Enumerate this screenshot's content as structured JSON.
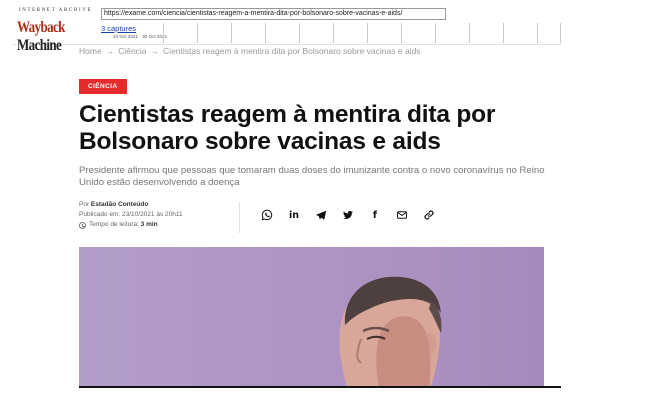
{
  "wayback": {
    "logo_top": "INTERNET ARCHIVE",
    "logo_main_1": "Wayback",
    "logo_main_2": "Machine",
    "url": "https://exame.com/ciencia/cientistas-reagem-a-mentira-dita-por-bolsonaro-sobre-vacinas-e-aids/",
    "captures": "3 captures",
    "date_range": "24 Oct 2021 - 30 Oct 2021"
  },
  "breadcrumb": {
    "home": "Home",
    "sep": "→",
    "section": "Ciência",
    "current": "Cientistas reagem à mentira dita por Bolsonaro sobre vacinas e aids"
  },
  "article": {
    "category": "CIÊNCIA",
    "title": "Cientistas reagem à mentira dita por Bolsonaro sobre vacinas e aids",
    "subtitle": "Presidente afirmou que pessoas que tomaram duas doses do imunizante contra o novo coronavírus no Reino Unido estão desenvolvendo a doença",
    "author_prefix": "Por ",
    "author": "Estadão Conteúdo",
    "published": "Publicado em: 23/10/2021 às 20h11",
    "read_time_label": "Tempo de leitura: ",
    "read_time": "3 min"
  },
  "share": {
    "icons": [
      "whatsapp-icon",
      "linkedin-icon",
      "telegram-icon",
      "twitter-icon",
      "facebook-icon",
      "email-icon",
      "link-icon"
    ],
    "linkedin_text": "in",
    "facebook_text": "f"
  },
  "colors": {
    "category_bg": "#e52b2b",
    "hero_bg": "#b49dc7",
    "wayback_red": "#ab2e1a"
  }
}
